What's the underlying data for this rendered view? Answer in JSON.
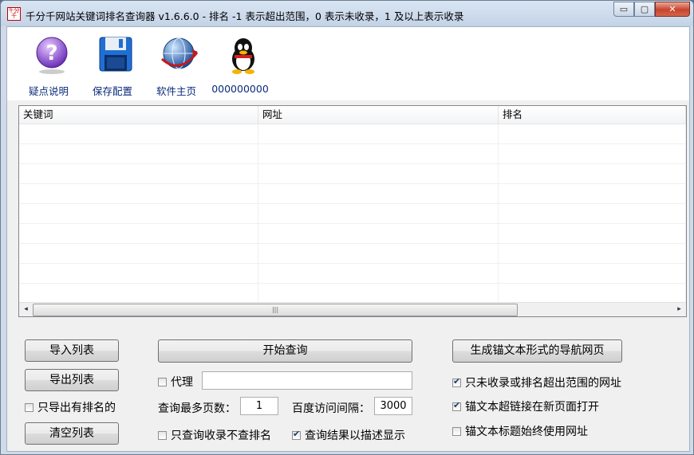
{
  "window": {
    "title": "千分千网站关键词排名查询器 v1.6.6.0 - 排名 -1 表示超出范围，0 表示未收录，1 及以上表示收录",
    "app_icon_text": "千分千",
    "controls": {
      "minimize": "▭",
      "maximize": "▢",
      "close": "✕"
    }
  },
  "toolbar": {
    "items": [
      {
        "label": "疑点说明",
        "icon": "help-icon"
      },
      {
        "label": "保存配置",
        "icon": "floppy-disk-icon"
      },
      {
        "label": "软件主页",
        "icon": "globe-icon"
      },
      {
        "label": "000000000",
        "icon": "qq-penguin-icon"
      }
    ]
  },
  "table": {
    "columns": [
      "关键词",
      "网址",
      "排名"
    ],
    "rows": [],
    "scroll_arrow_left": "◂",
    "scroll_arrow_right": "▸",
    "scroll_thumb_grip": "|||"
  },
  "left_buttons": {
    "import": "导入列表",
    "export": "导出列表",
    "export_ranked_only": {
      "label": "只导出有排名的",
      "checked": false
    },
    "clear": "清空列表"
  },
  "center": {
    "start_button": "开始查询",
    "proxy": {
      "label": "代理",
      "checked": false,
      "value": ""
    },
    "max_pages": {
      "label": "查询最多页数：",
      "value": "1"
    },
    "interval": {
      "label": "百度访问间隔：",
      "value": "3000"
    },
    "only_indexed": {
      "label": "只查询收录不查排名",
      "checked": false
    },
    "desc_display": {
      "label": "查询结果以描述显示",
      "checked": true
    }
  },
  "right": {
    "generate_button": "生成锚文本形式的导航网页",
    "only_unindexed": {
      "label": "只未收录或排名超出范围的网址",
      "checked": true
    },
    "open_new_page": {
      "label": "锚文本超链接在新页面打开",
      "checked": true
    },
    "title_use_url": {
      "label": "锚文本标题始终使用网址",
      "checked": false
    }
  },
  "check_glyph": "✔",
  "colors": {
    "title_bg": "#cfdbe9",
    "close_red": "#c8432c",
    "toolbar_label": "#0a2a7a"
  }
}
